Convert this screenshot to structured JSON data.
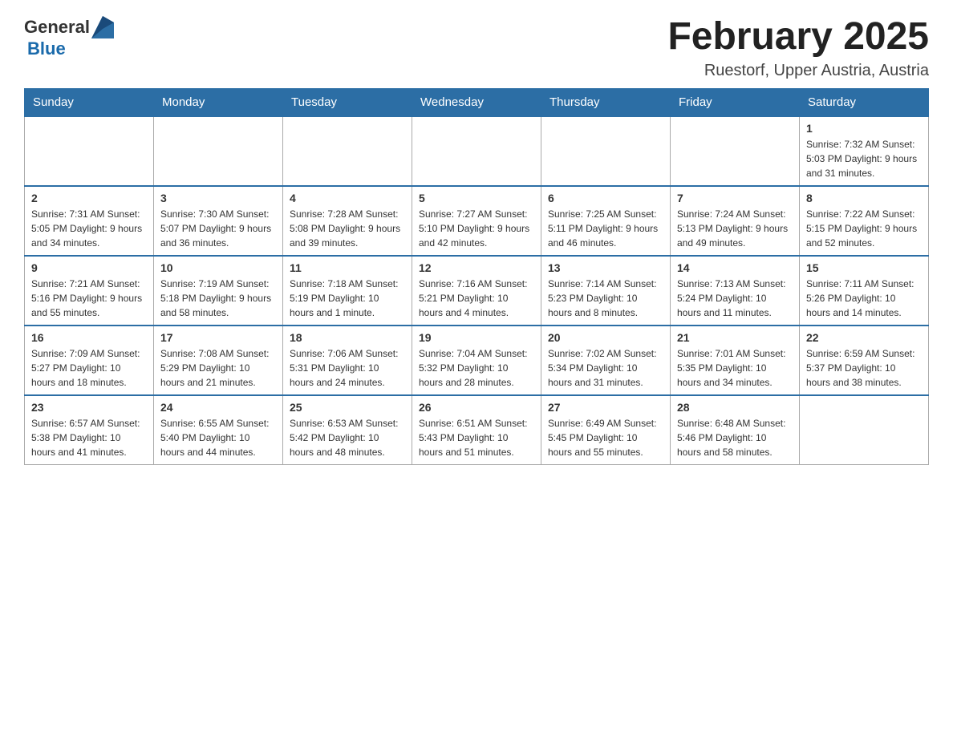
{
  "header": {
    "logo_general": "General",
    "logo_blue": "Blue",
    "month_title": "February 2025",
    "location": "Ruestorf, Upper Austria, Austria"
  },
  "weekdays": [
    "Sunday",
    "Monday",
    "Tuesday",
    "Wednesday",
    "Thursday",
    "Friday",
    "Saturday"
  ],
  "weeks": [
    [
      {
        "day": "",
        "info": ""
      },
      {
        "day": "",
        "info": ""
      },
      {
        "day": "",
        "info": ""
      },
      {
        "day": "",
        "info": ""
      },
      {
        "day": "",
        "info": ""
      },
      {
        "day": "",
        "info": ""
      },
      {
        "day": "1",
        "info": "Sunrise: 7:32 AM\nSunset: 5:03 PM\nDaylight: 9 hours and 31 minutes."
      }
    ],
    [
      {
        "day": "2",
        "info": "Sunrise: 7:31 AM\nSunset: 5:05 PM\nDaylight: 9 hours and 34 minutes."
      },
      {
        "day": "3",
        "info": "Sunrise: 7:30 AM\nSunset: 5:07 PM\nDaylight: 9 hours and 36 minutes."
      },
      {
        "day": "4",
        "info": "Sunrise: 7:28 AM\nSunset: 5:08 PM\nDaylight: 9 hours and 39 minutes."
      },
      {
        "day": "5",
        "info": "Sunrise: 7:27 AM\nSunset: 5:10 PM\nDaylight: 9 hours and 42 minutes."
      },
      {
        "day": "6",
        "info": "Sunrise: 7:25 AM\nSunset: 5:11 PM\nDaylight: 9 hours and 46 minutes."
      },
      {
        "day": "7",
        "info": "Sunrise: 7:24 AM\nSunset: 5:13 PM\nDaylight: 9 hours and 49 minutes."
      },
      {
        "day": "8",
        "info": "Sunrise: 7:22 AM\nSunset: 5:15 PM\nDaylight: 9 hours and 52 minutes."
      }
    ],
    [
      {
        "day": "9",
        "info": "Sunrise: 7:21 AM\nSunset: 5:16 PM\nDaylight: 9 hours and 55 minutes."
      },
      {
        "day": "10",
        "info": "Sunrise: 7:19 AM\nSunset: 5:18 PM\nDaylight: 9 hours and 58 minutes."
      },
      {
        "day": "11",
        "info": "Sunrise: 7:18 AM\nSunset: 5:19 PM\nDaylight: 10 hours and 1 minute."
      },
      {
        "day": "12",
        "info": "Sunrise: 7:16 AM\nSunset: 5:21 PM\nDaylight: 10 hours and 4 minutes."
      },
      {
        "day": "13",
        "info": "Sunrise: 7:14 AM\nSunset: 5:23 PM\nDaylight: 10 hours and 8 minutes."
      },
      {
        "day": "14",
        "info": "Sunrise: 7:13 AM\nSunset: 5:24 PM\nDaylight: 10 hours and 11 minutes."
      },
      {
        "day": "15",
        "info": "Sunrise: 7:11 AM\nSunset: 5:26 PM\nDaylight: 10 hours and 14 minutes."
      }
    ],
    [
      {
        "day": "16",
        "info": "Sunrise: 7:09 AM\nSunset: 5:27 PM\nDaylight: 10 hours and 18 minutes."
      },
      {
        "day": "17",
        "info": "Sunrise: 7:08 AM\nSunset: 5:29 PM\nDaylight: 10 hours and 21 minutes."
      },
      {
        "day": "18",
        "info": "Sunrise: 7:06 AM\nSunset: 5:31 PM\nDaylight: 10 hours and 24 minutes."
      },
      {
        "day": "19",
        "info": "Sunrise: 7:04 AM\nSunset: 5:32 PM\nDaylight: 10 hours and 28 minutes."
      },
      {
        "day": "20",
        "info": "Sunrise: 7:02 AM\nSunset: 5:34 PM\nDaylight: 10 hours and 31 minutes."
      },
      {
        "day": "21",
        "info": "Sunrise: 7:01 AM\nSunset: 5:35 PM\nDaylight: 10 hours and 34 minutes."
      },
      {
        "day": "22",
        "info": "Sunrise: 6:59 AM\nSunset: 5:37 PM\nDaylight: 10 hours and 38 minutes."
      }
    ],
    [
      {
        "day": "23",
        "info": "Sunrise: 6:57 AM\nSunset: 5:38 PM\nDaylight: 10 hours and 41 minutes."
      },
      {
        "day": "24",
        "info": "Sunrise: 6:55 AM\nSunset: 5:40 PM\nDaylight: 10 hours and 44 minutes."
      },
      {
        "day": "25",
        "info": "Sunrise: 6:53 AM\nSunset: 5:42 PM\nDaylight: 10 hours and 48 minutes."
      },
      {
        "day": "26",
        "info": "Sunrise: 6:51 AM\nSunset: 5:43 PM\nDaylight: 10 hours and 51 minutes."
      },
      {
        "day": "27",
        "info": "Sunrise: 6:49 AM\nSunset: 5:45 PM\nDaylight: 10 hours and 55 minutes."
      },
      {
        "day": "28",
        "info": "Sunrise: 6:48 AM\nSunset: 5:46 PM\nDaylight: 10 hours and 58 minutes."
      },
      {
        "day": "",
        "info": ""
      }
    ]
  ]
}
